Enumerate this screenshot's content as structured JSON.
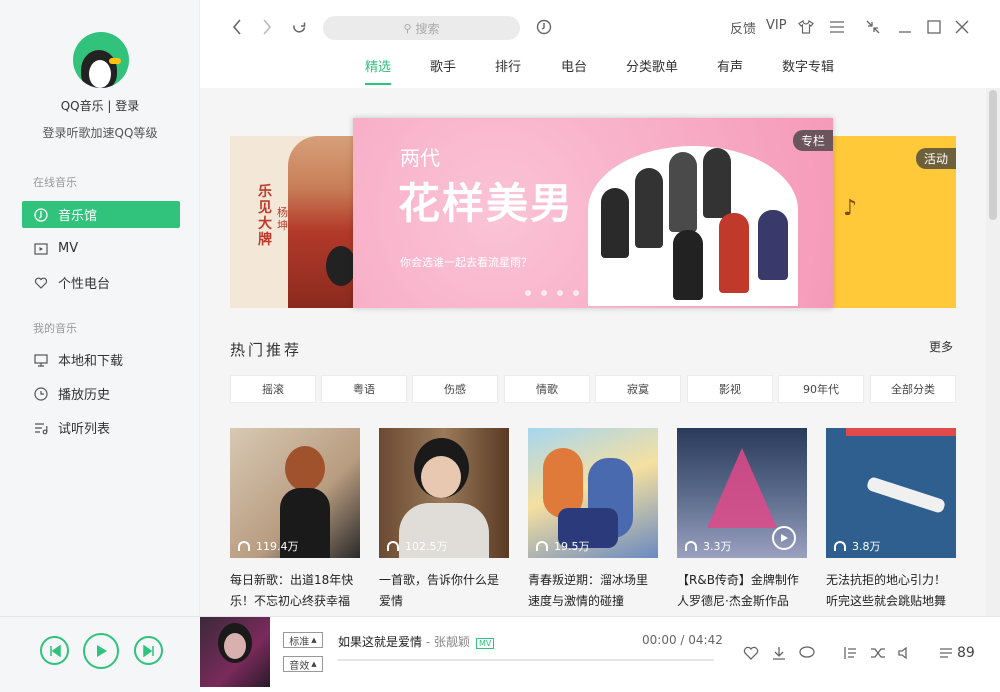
{
  "sidebar": {
    "username": "QQ音乐 | 登录",
    "login_tip": "登录听歌加速QQ等级",
    "section_online": "在线音乐",
    "section_mine": "我的音乐",
    "online_items": [
      {
        "label": "音乐馆",
        "icon": "music-hall-icon"
      },
      {
        "label": "MV",
        "icon": "mv-icon"
      },
      {
        "label": "个性电台",
        "icon": "radio-heart-icon"
      }
    ],
    "my_items": [
      {
        "label": "本地和下载",
        "icon": "monitor-icon"
      },
      {
        "label": "播放历史",
        "icon": "clock-icon"
      },
      {
        "label": "试听列表",
        "icon": "playlist-icon"
      }
    ]
  },
  "topbar": {
    "search_placeholder": "搜索",
    "feedback": "反馈",
    "vip": "VIP",
    "tabs": [
      "精选",
      "歌手",
      "排行",
      "电台",
      "分类歌单",
      "有声",
      "数字专辑"
    ],
    "active_tab": "精选"
  },
  "banner": {
    "left_text_1": "乐见大牌",
    "left_text_2": "杨坤",
    "main_title_small": "两代",
    "main_title_big": "花样美男",
    "main_subtitle": "你会选谁一起去看流星雨？",
    "main_tag": "专栏",
    "right_tag": "活动"
  },
  "hot": {
    "title": "热门推荐",
    "more": "更多",
    "categories": [
      "摇滚",
      "粤语",
      "伤感",
      "情歌",
      "寂寞",
      "影视",
      "90年代",
      "全部分类"
    ],
    "cards": [
      {
        "plays": "119.4万",
        "title": "每日新歌：出道18年快乐！不忘初心终获幸福"
      },
      {
        "plays": "102.5万",
        "title": "一首歌，告诉你什么是爱情"
      },
      {
        "plays": "19.5万",
        "title": "青春叛逆期：溜冰场里速度与激情的碰撞"
      },
      {
        "plays": "3.3万",
        "title": "【R&B传奇】金牌制作人罗德尼·杰金斯作品"
      },
      {
        "plays": "3.8万",
        "title": "无法抗拒的地心引力！听完这些就会跳贴地舞"
      }
    ]
  },
  "player": {
    "quality_1": "标准",
    "quality_2": "音效",
    "song_title": "如果这就是爱情",
    "song_artist": " - 张靓颖",
    "mv": "MV",
    "time": "00:00 / 04:42",
    "count": "89"
  },
  "colors": {
    "accent": "#31c27c"
  }
}
